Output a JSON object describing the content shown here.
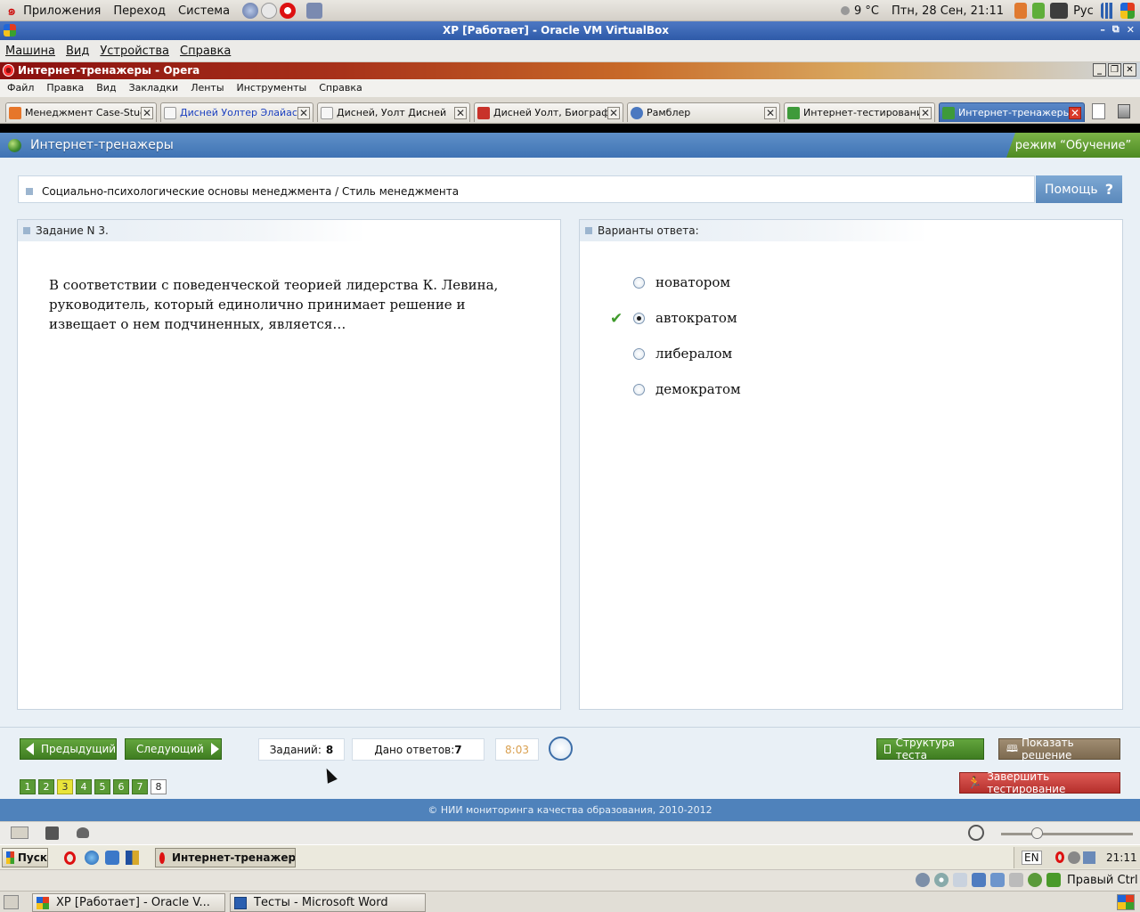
{
  "gnome_top": {
    "menus": [
      "Приложения",
      "Переход",
      "Система"
    ],
    "weather": "9 °C",
    "datetime": "Птн, 28 Сен, 21:11",
    "lang": "Рус"
  },
  "vbox": {
    "title": "XP [Работает] - Oracle VM VirtualBox",
    "menus": [
      "Машина",
      "Вид",
      "Устройства",
      "Справка"
    ]
  },
  "opera": {
    "title": "Интернет-тренажеры - Opera",
    "menus": [
      "Файл",
      "Правка",
      "Вид",
      "Закладки",
      "Ленты",
      "Инструменты",
      "Справка"
    ],
    "tabs": [
      {
        "label": "Менеджмент Case-Stud...",
        "icon_color": "#e6762a"
      },
      {
        "label": "Дисней Уолтер Элайас",
        "icon_color": "#f4f4f4"
      },
      {
        "label": "Дисней, Уолт Дисней",
        "icon_color": "#f4f4f4"
      },
      {
        "label": "Дисней Уолт, Биограф...",
        "icon_color": "#c8322a"
      },
      {
        "label": "Рамблер",
        "icon_color": "#4a78c0"
      },
      {
        "label": "Интернет-тестирование",
        "icon_color": "#3e9a3a"
      },
      {
        "label": "Интернет-тренажеры",
        "icon_color": "#3e9a3a"
      }
    ]
  },
  "app": {
    "title": "Интернет-тренажеры",
    "mode": "режим “Обучение”",
    "breadcrumb": "Социально-психологические основы менеджмента / Стиль менеджмента",
    "help_label": "Помощь",
    "task_header": "Задание N 3.",
    "question": "В соответствии с поведенческой теорией лидерства К. Левина, руководитель, который единолично принимает решение и извещает о нем подчиненных, является…",
    "answers_header": "Варианты ответа:",
    "answers": [
      {
        "text": "новатором",
        "selected": false,
        "correct": false
      },
      {
        "text": "автократом",
        "selected": true,
        "correct": true
      },
      {
        "text": "либералом",
        "selected": false,
        "correct": false
      },
      {
        "text": "демократом",
        "selected": false,
        "correct": false
      }
    ],
    "prev_label": "Предыдущий",
    "next_label": "Следующий",
    "tasks_label": "Заданий:",
    "tasks_count": "8",
    "answered_label": "Дано ответов:",
    "answered_count": "7",
    "timer": "8:03",
    "structure_label": "Структура теста",
    "show_solution_label": "Показать решение",
    "finish_label": "Завершить тестирование",
    "pages": [
      "1",
      "2",
      "3",
      "4",
      "5",
      "6",
      "7",
      "8"
    ],
    "current_page": "3",
    "footer": "© НИИ мониторинга качества образования, 2010-2012"
  },
  "xp_taskbar": {
    "start": "Пуск",
    "task": "Интернет-тренажер...",
    "lang": "EN",
    "clock": "21:11"
  },
  "gnome_bottom": {
    "tasks": [
      "XP [Работает] - Oracle V...",
      "Тесты - Microsoft Word"
    ],
    "host_key": "Правый Ctrl"
  },
  "colors": {
    "accent_blue": "#4f82bb",
    "green_button": "#4f8f2c",
    "brown_button": "#8c7a62",
    "red_button": "#c9403c",
    "timer_text": "#d9a050"
  }
}
